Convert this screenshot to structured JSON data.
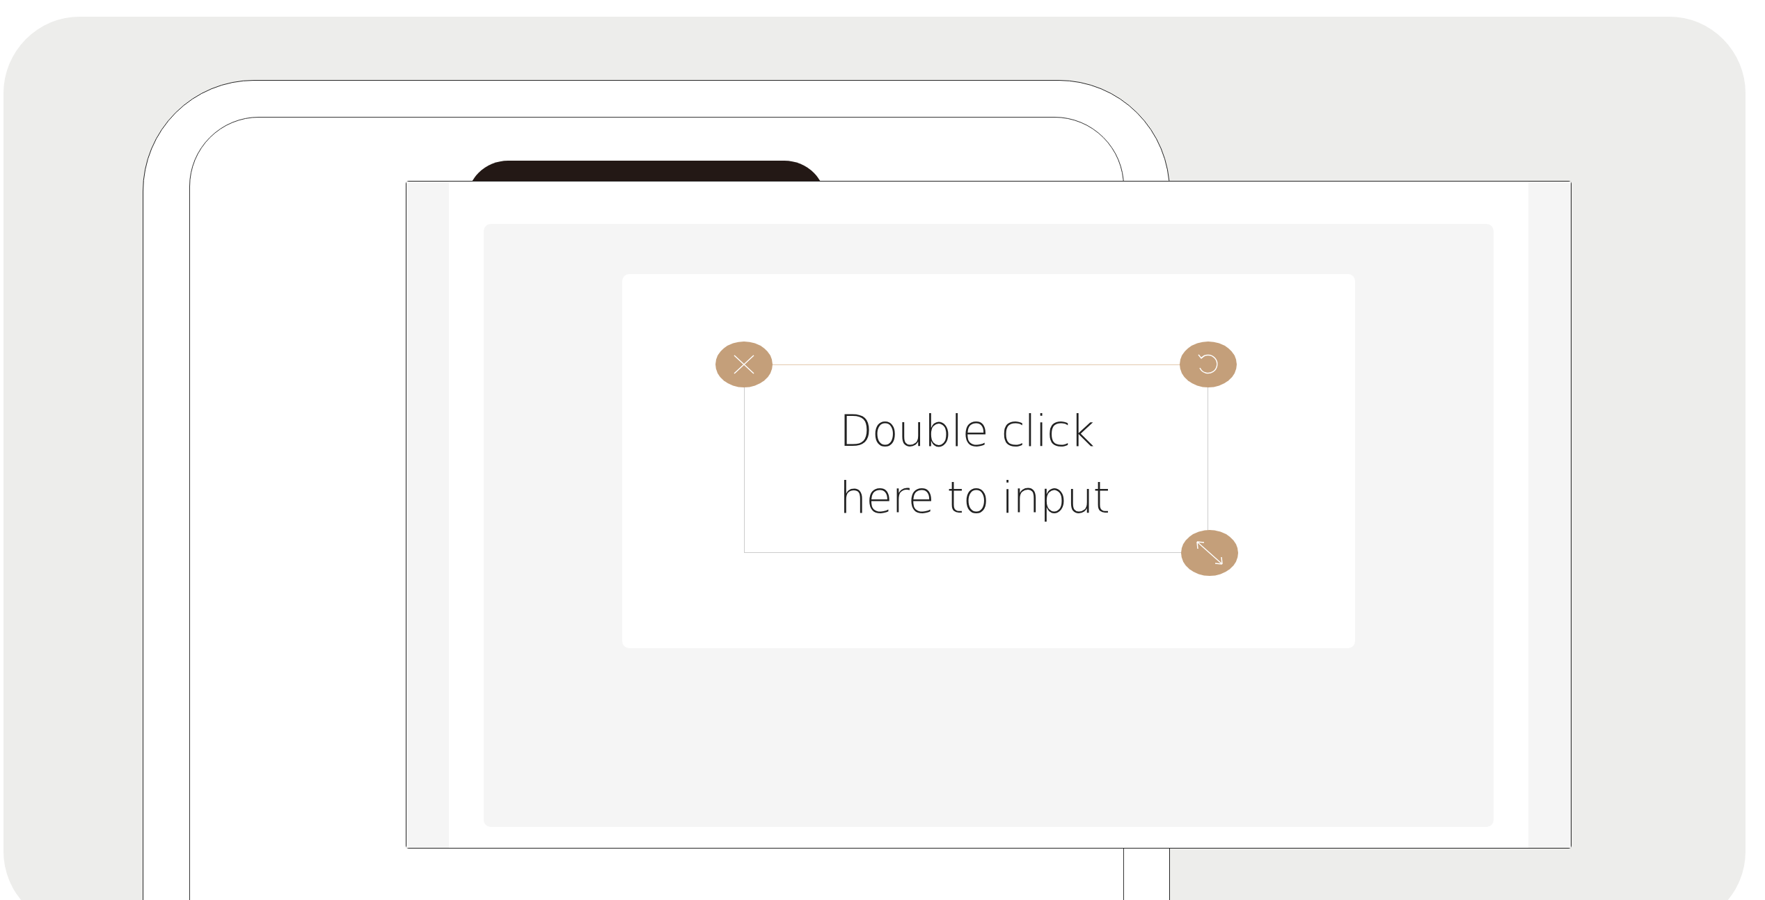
{
  "text_box": {
    "text": "Double click here to input"
  }
}
